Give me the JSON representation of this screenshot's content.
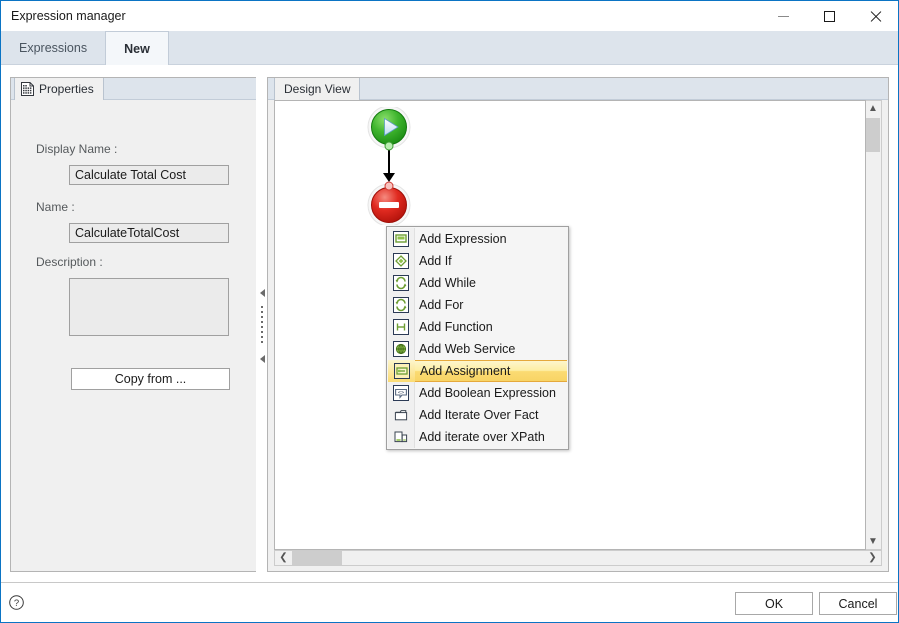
{
  "window": {
    "title": "Expression manager",
    "controls": {
      "minimize": "Minimize",
      "maximize": "Maximize",
      "close": "Close"
    }
  },
  "tabs": [
    {
      "label": "Expressions",
      "active": false
    },
    {
      "label": "New",
      "active": true
    }
  ],
  "properties_panel": {
    "tab_label": "Properties",
    "tab_icon": "properties-page-icon",
    "fields": {
      "display_name": {
        "label": "Display Name :",
        "value": "Calculate Total Cost",
        "placeholder": ""
      },
      "name": {
        "label": "Name :",
        "value": "CalculateTotalCost",
        "placeholder": ""
      },
      "description": {
        "label": "Description :",
        "value": "",
        "placeholder": ""
      }
    },
    "copy_from_label": "Copy from ..."
  },
  "splitter": {
    "collapse_icon_top": "triangle-left-icon",
    "collapse_icon_bottom": "triangle-left-icon"
  },
  "design_panel": {
    "tab_label": "Design View",
    "nodes": [
      {
        "name": "start-node",
        "type": "start",
        "color": "#2aa02a"
      },
      {
        "name": "end-node",
        "type": "end",
        "color": "#e02020"
      }
    ],
    "scrollbars": {
      "vertical": {
        "up": "▲",
        "down": "▼"
      },
      "horizontal": {
        "left": "❮",
        "right": "❯"
      }
    }
  },
  "context_menu": {
    "selected_index": 6,
    "highlight_color": "#fbdb73",
    "highlight_border": "#e5a93c",
    "items": [
      {
        "label": "Add Expression",
        "icon": "expression-icon"
      },
      {
        "label": "Add If",
        "icon": "if-diamond-icon"
      },
      {
        "label": "Add While",
        "icon": "while-loop-icon"
      },
      {
        "label": "Add For",
        "icon": "for-loop-icon"
      },
      {
        "label": "Add Function",
        "icon": "function-icon"
      },
      {
        "label": "Add Web Service",
        "icon": "web-service-icon"
      },
      {
        "label": "Add Assignment",
        "icon": "assignment-icon"
      },
      {
        "label": "Add Boolean Expression",
        "icon": "boolean-expression-icon"
      },
      {
        "label": "Add Iterate Over Fact",
        "icon": "iterate-fact-icon"
      },
      {
        "label": "Add iterate over XPath",
        "icon": "iterate-xpath-icon"
      }
    ]
  },
  "footer": {
    "help_icon": "help-question-icon",
    "ok_label": "OK",
    "cancel_label": "Cancel"
  }
}
